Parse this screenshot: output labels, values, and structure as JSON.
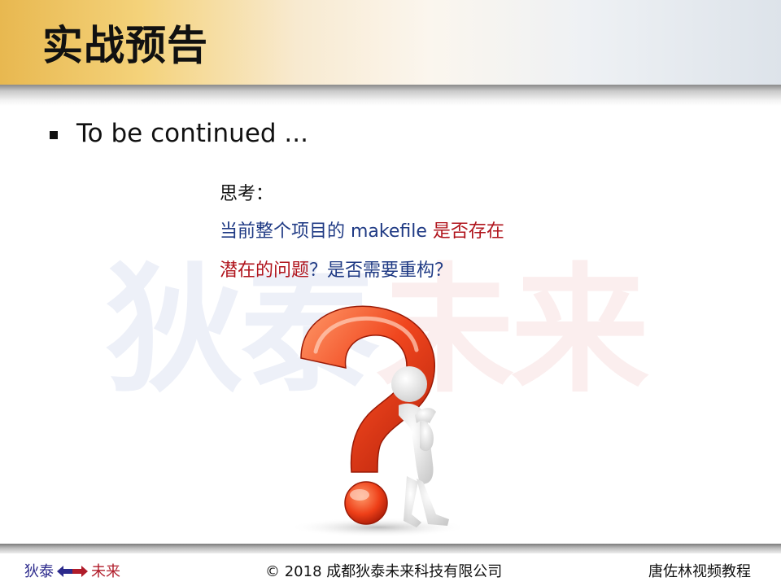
{
  "slide": {
    "title": "实战预告",
    "bullet": "To be continued ...",
    "watermark": {
      "part1": "狄泰",
      "part2": "未来"
    },
    "thinking": {
      "line1": "思考：",
      "line2_a": "当前整个项目的 makefile ",
      "line2_b": "是否存在",
      "line3_a": "潜在的问题",
      "line3_b": "？是否需要重构？"
    },
    "colors": {
      "blue": "#1f3a84",
      "red": "#b0141c"
    },
    "graphic_icon": "question-mark-thinker-icon"
  },
  "footer": {
    "left_a": "狄泰",
    "left_b": "未来",
    "center": "© 2018 成都狄泰未来科技有限公司",
    "right": "唐佐林视频教程"
  }
}
